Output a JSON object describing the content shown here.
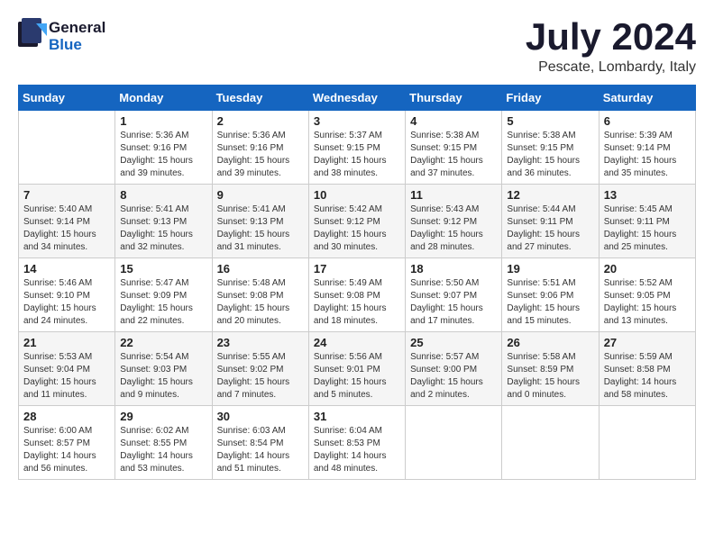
{
  "logo": {
    "general": "General",
    "blue": "Blue"
  },
  "title": {
    "month": "July 2024",
    "location": "Pescate, Lombardy, Italy"
  },
  "headers": [
    "Sunday",
    "Monday",
    "Tuesday",
    "Wednesday",
    "Thursday",
    "Friday",
    "Saturday"
  ],
  "weeks": [
    [
      {
        "day": "",
        "info": ""
      },
      {
        "day": "1",
        "info": "Sunrise: 5:36 AM\nSunset: 9:16 PM\nDaylight: 15 hours\nand 39 minutes."
      },
      {
        "day": "2",
        "info": "Sunrise: 5:36 AM\nSunset: 9:16 PM\nDaylight: 15 hours\nand 39 minutes."
      },
      {
        "day": "3",
        "info": "Sunrise: 5:37 AM\nSunset: 9:15 PM\nDaylight: 15 hours\nand 38 minutes."
      },
      {
        "day": "4",
        "info": "Sunrise: 5:38 AM\nSunset: 9:15 PM\nDaylight: 15 hours\nand 37 minutes."
      },
      {
        "day": "5",
        "info": "Sunrise: 5:38 AM\nSunset: 9:15 PM\nDaylight: 15 hours\nand 36 minutes."
      },
      {
        "day": "6",
        "info": "Sunrise: 5:39 AM\nSunset: 9:14 PM\nDaylight: 15 hours\nand 35 minutes."
      }
    ],
    [
      {
        "day": "7",
        "info": "Sunrise: 5:40 AM\nSunset: 9:14 PM\nDaylight: 15 hours\nand 34 minutes."
      },
      {
        "day": "8",
        "info": "Sunrise: 5:41 AM\nSunset: 9:13 PM\nDaylight: 15 hours\nand 32 minutes."
      },
      {
        "day": "9",
        "info": "Sunrise: 5:41 AM\nSunset: 9:13 PM\nDaylight: 15 hours\nand 31 minutes."
      },
      {
        "day": "10",
        "info": "Sunrise: 5:42 AM\nSunset: 9:12 PM\nDaylight: 15 hours\nand 30 minutes."
      },
      {
        "day": "11",
        "info": "Sunrise: 5:43 AM\nSunset: 9:12 PM\nDaylight: 15 hours\nand 28 minutes."
      },
      {
        "day": "12",
        "info": "Sunrise: 5:44 AM\nSunset: 9:11 PM\nDaylight: 15 hours\nand 27 minutes."
      },
      {
        "day": "13",
        "info": "Sunrise: 5:45 AM\nSunset: 9:11 PM\nDaylight: 15 hours\nand 25 minutes."
      }
    ],
    [
      {
        "day": "14",
        "info": "Sunrise: 5:46 AM\nSunset: 9:10 PM\nDaylight: 15 hours\nand 24 minutes."
      },
      {
        "day": "15",
        "info": "Sunrise: 5:47 AM\nSunset: 9:09 PM\nDaylight: 15 hours\nand 22 minutes."
      },
      {
        "day": "16",
        "info": "Sunrise: 5:48 AM\nSunset: 9:08 PM\nDaylight: 15 hours\nand 20 minutes."
      },
      {
        "day": "17",
        "info": "Sunrise: 5:49 AM\nSunset: 9:08 PM\nDaylight: 15 hours\nand 18 minutes."
      },
      {
        "day": "18",
        "info": "Sunrise: 5:50 AM\nSunset: 9:07 PM\nDaylight: 15 hours\nand 17 minutes."
      },
      {
        "day": "19",
        "info": "Sunrise: 5:51 AM\nSunset: 9:06 PM\nDaylight: 15 hours\nand 15 minutes."
      },
      {
        "day": "20",
        "info": "Sunrise: 5:52 AM\nSunset: 9:05 PM\nDaylight: 15 hours\nand 13 minutes."
      }
    ],
    [
      {
        "day": "21",
        "info": "Sunrise: 5:53 AM\nSunset: 9:04 PM\nDaylight: 15 hours\nand 11 minutes."
      },
      {
        "day": "22",
        "info": "Sunrise: 5:54 AM\nSunset: 9:03 PM\nDaylight: 15 hours\nand 9 minutes."
      },
      {
        "day": "23",
        "info": "Sunrise: 5:55 AM\nSunset: 9:02 PM\nDaylight: 15 hours\nand 7 minutes."
      },
      {
        "day": "24",
        "info": "Sunrise: 5:56 AM\nSunset: 9:01 PM\nDaylight: 15 hours\nand 5 minutes."
      },
      {
        "day": "25",
        "info": "Sunrise: 5:57 AM\nSunset: 9:00 PM\nDaylight: 15 hours\nand 2 minutes."
      },
      {
        "day": "26",
        "info": "Sunrise: 5:58 AM\nSunset: 8:59 PM\nDaylight: 15 hours\nand 0 minutes."
      },
      {
        "day": "27",
        "info": "Sunrise: 5:59 AM\nSunset: 8:58 PM\nDaylight: 14 hours\nand 58 minutes."
      }
    ],
    [
      {
        "day": "28",
        "info": "Sunrise: 6:00 AM\nSunset: 8:57 PM\nDaylight: 14 hours\nand 56 minutes."
      },
      {
        "day": "29",
        "info": "Sunrise: 6:02 AM\nSunset: 8:55 PM\nDaylight: 14 hours\nand 53 minutes."
      },
      {
        "day": "30",
        "info": "Sunrise: 6:03 AM\nSunset: 8:54 PM\nDaylight: 14 hours\nand 51 minutes."
      },
      {
        "day": "31",
        "info": "Sunrise: 6:04 AM\nSunset: 8:53 PM\nDaylight: 14 hours\nand 48 minutes."
      },
      {
        "day": "",
        "info": ""
      },
      {
        "day": "",
        "info": ""
      },
      {
        "day": "",
        "info": ""
      }
    ]
  ]
}
